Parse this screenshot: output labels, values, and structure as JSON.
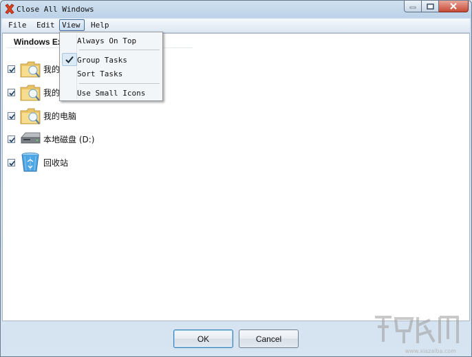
{
  "window": {
    "title": "Close All Windows",
    "icon": "red-x-icon"
  },
  "menubar": {
    "file": "File",
    "edit": "Edit",
    "view": "View",
    "help": "Help"
  },
  "tab": {
    "label": "Windows Ex"
  },
  "rows": [
    {
      "label": "我的",
      "icon": "folder-icon",
      "checked": true
    },
    {
      "label": "我的",
      "icon": "folder-icon",
      "checked": true
    },
    {
      "label": "我的电脑",
      "icon": "folder-icon",
      "checked": true
    },
    {
      "label": "本地磁盘 (D:)",
      "icon": "hard-drive-icon",
      "checked": true
    },
    {
      "label": "回收站",
      "icon": "recycle-bin-icon",
      "checked": true
    }
  ],
  "view_menu": {
    "always_on_top": "Always On Top",
    "group_tasks": "Group Tasks",
    "group_tasks_checked": true,
    "sort_tasks": "Sort Tasks",
    "use_small_icons": "Use Small Icons"
  },
  "buttons": {
    "ok": "OK",
    "cancel": "Cancel"
  },
  "watermark": {
    "url": "www.xiazaiba.com"
  },
  "colors": {
    "accent": "#3c7fb1",
    "title_icon": "#e0431f"
  }
}
